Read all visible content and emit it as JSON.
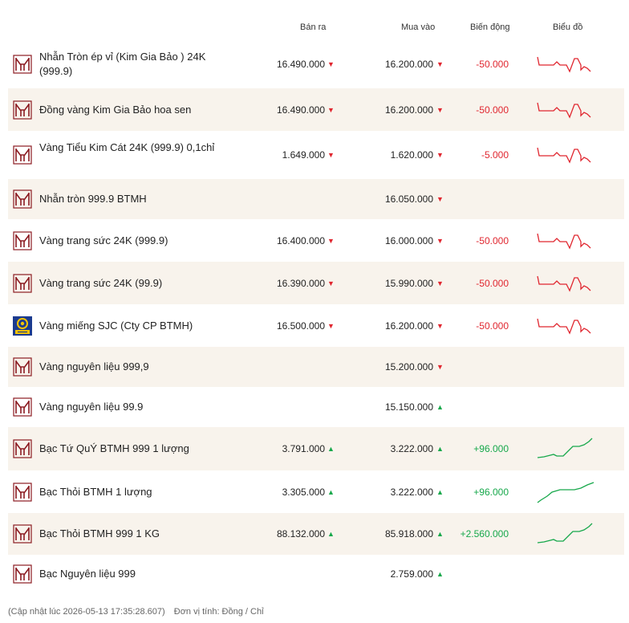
{
  "header": {
    "sell": "Bán ra",
    "buy": "Mua vào",
    "change": "Biến động",
    "chart": "Biểu đồ"
  },
  "rows": [
    {
      "name": "Nhẫn Tròn ép vỉ (Kim Gia Bảo ) 24K (999.9)",
      "sell": "16.490.000",
      "buy": "16.200.000",
      "change": "-50.000",
      "trend": "down",
      "logo": "btmh-logo-icon"
    },
    {
      "name": "Đồng vàng Kim Gia Bảo hoa sen",
      "sell": "16.490.000",
      "buy": "16.200.000",
      "change": "-50.000",
      "trend": "down",
      "logo": "btmh-logo-icon"
    },
    {
      "name": "Vàng Tiểu Kim Cát 24K (999.9) 0,1chỉ",
      "sell": "1.649.000",
      "buy": "1.620.000",
      "change": "-5.000",
      "trend": "down",
      "logo": "btmh-logo-icon"
    },
    {
      "name": "Nhẫn tròn 999.9 BTMH",
      "sell": "",
      "buy": "16.050.000",
      "change": "",
      "trend": "down",
      "logo": "btmh-logo-icon"
    },
    {
      "name": "Vàng trang sức 24K (999.9)",
      "sell": "16.400.000",
      "buy": "16.000.000",
      "change": "-50.000",
      "trend": "down",
      "logo": "btmh-logo-icon"
    },
    {
      "name": "Vàng trang sức 24K (99.9)",
      "sell": "16.390.000",
      "buy": "15.990.000",
      "change": "-50.000",
      "trend": "down",
      "logo": "btmh-logo-icon"
    },
    {
      "name": "Vàng miếng SJC (Cty CP BTMH)",
      "sell": "16.500.000",
      "buy": "16.200.000",
      "change": "-50.000",
      "trend": "down",
      "logo": "sjc-logo-icon"
    },
    {
      "name": "Vàng nguyên liệu 999,9",
      "sell": "",
      "buy": "15.200.000",
      "change": "",
      "trend": "down",
      "logo": "btmh-logo-icon"
    },
    {
      "name": "Vàng nguyên liệu 99.9",
      "sell": "",
      "buy": "15.150.000",
      "change": "",
      "trend": "up",
      "logo": "btmh-logo-icon"
    },
    {
      "name": "Bạc Tứ QuÝ BTMH 999 1 lượng",
      "sell": "3.791.000",
      "buy": "3.222.000",
      "change": "+96.000",
      "trend": "up",
      "logo": "btmh-logo-icon"
    },
    {
      "name": "Bạc Thỏi BTMH 1 lượng",
      "sell": "3.305.000",
      "buy": "3.222.000",
      "change": "+96.000",
      "trend": "up",
      "logo": "btmh-logo-icon"
    },
    {
      "name": "Bạc Thỏi BTMH 999 1 KG",
      "sell": "88.132.000",
      "buy": "85.918.000",
      "change": "+2.560.000",
      "trend": "up",
      "logo": "btmh-logo-icon"
    },
    {
      "name": "Bạc Nguyên liệu 999",
      "sell": "",
      "buy": "2.759.000",
      "change": "",
      "trend": "up",
      "logo": "btmh-logo-icon"
    }
  ],
  "footer": {
    "updated": "(Cập nhật lúc 2026-05-13 17:35:28.607)",
    "unit": "Đơn vị tính: Đồng / Chỉ"
  },
  "colors": {
    "down": "#e0262f",
    "up": "#17a84b",
    "alt_row": "#f8f3ec",
    "brand": "#8c1c22",
    "sjc_blue": "#1b3b8f",
    "sjc_gold": "#f3c200"
  }
}
